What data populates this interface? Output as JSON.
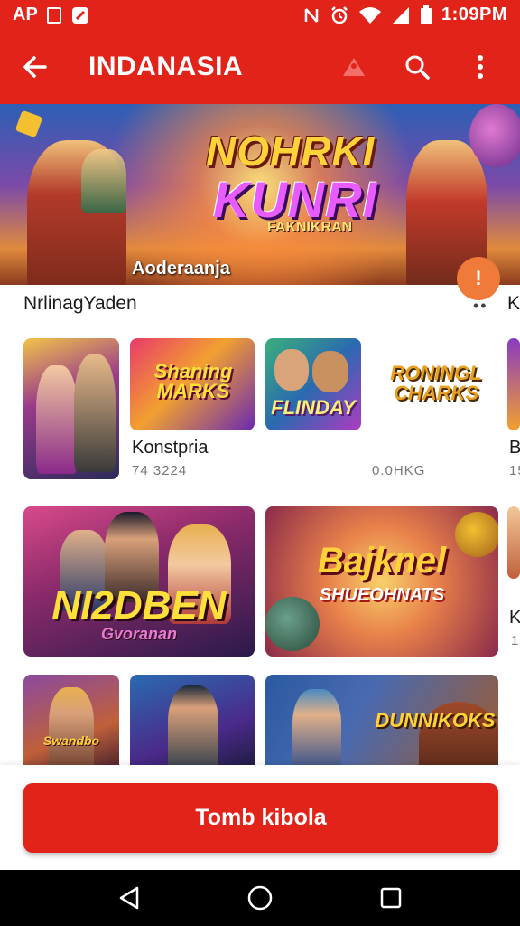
{
  "status_bar": {
    "left_text": "AP",
    "time": "1:09PM",
    "icons": [
      "sim-box-icon",
      "app-notification-icon",
      "nfc-icon",
      "alarm-icon",
      "wifi-icon",
      "signal-icon",
      "battery-icon"
    ]
  },
  "app_bar": {
    "title": "INDANASIA",
    "icons": [
      "back-arrow-icon",
      "warning-icon",
      "search-icon",
      "more-vert-icon"
    ]
  },
  "hero": {
    "title_line1": "NOHRKI",
    "title_line2": "KUNRI",
    "title_line3": "FAKNIKRAN",
    "caption": "Aoderaanja",
    "badge": "!"
  },
  "section": {
    "title": "NrlinagYaden",
    "more": "••",
    "edge_text": "K"
  },
  "row1": {
    "tile2_text": "Shaning MARKS",
    "tile3_text": "FLINDAY",
    "tile4_text": "RONINGL CHARKS",
    "caption": "Konstpria",
    "sub_left": "74 3224",
    "sub_right": "0.0HKG",
    "edge_caption": "B",
    "edge_sub": "15"
  },
  "row2": {
    "tile1_text_a": "NI2DBEN",
    "tile1_text_b": "Gvoranan",
    "tile2_text_a": "Bajknel",
    "tile2_text_b": "SHUEOHNATS",
    "edge_caption": "K",
    "edge_sub": "1"
  },
  "row3": {
    "tile1_text": "Swandbo",
    "tile3_text": "DUNNIKOKS"
  },
  "cta": {
    "label": "Tomb kibola"
  },
  "nav": {
    "icons": [
      "nav-back-icon",
      "nav-home-icon",
      "nav-recents-icon"
    ]
  },
  "colors": {
    "brand_red": "#e2231a",
    "nav_black": "#000000"
  }
}
